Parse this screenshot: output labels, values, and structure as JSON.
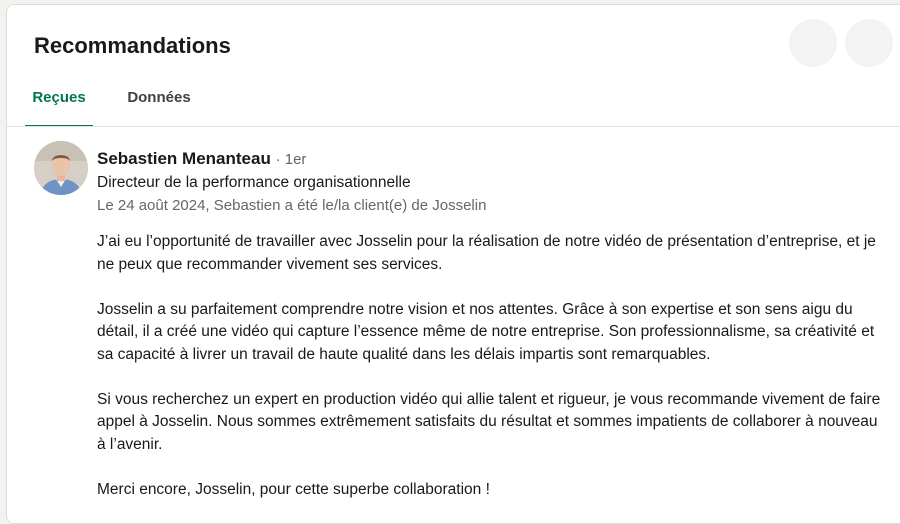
{
  "section": {
    "title": "Recommandations"
  },
  "tabs": [
    {
      "label": "Reçues",
      "active": true
    },
    {
      "label": "Données",
      "active": false
    }
  ],
  "colors": {
    "accent": "#01754f",
    "muted": "#666666"
  },
  "recommendation": {
    "name": "Sebastien Menanteau",
    "degree": "· 1er",
    "headline": "Directeur de la performance organisationnelle",
    "meta": "Le 24 août 2024, Sebastien a été le/la client(e) de Josselin",
    "paragraphs": [
      "J’ai eu l’opportunité de travailler avec Josselin pour la réalisation de notre vidéo de présentation d’entreprise, et je ne peux que recommander vivement ses services.",
      "Josselin a su parfaitement comprendre notre vision et nos attentes. Grâce à son expertise et son sens aigu du détail, il a créé une vidéo qui capture l’essence même de notre entreprise. Son professionnalisme, sa créativité et sa capacité à livrer un travail de haute qualité dans les délais impartis sont remarquables.",
      "Si vous recherchez un expert en production vidéo qui allie talent et rigueur, je vous recommande vivement de faire appel à Josselin. Nous sommes extrêmement satisfaits du résultat et sommes impatients de collaborer à nouveau à l’avenir.",
      "Merci encore, Josselin, pour cette superbe collaboration !"
    ]
  }
}
